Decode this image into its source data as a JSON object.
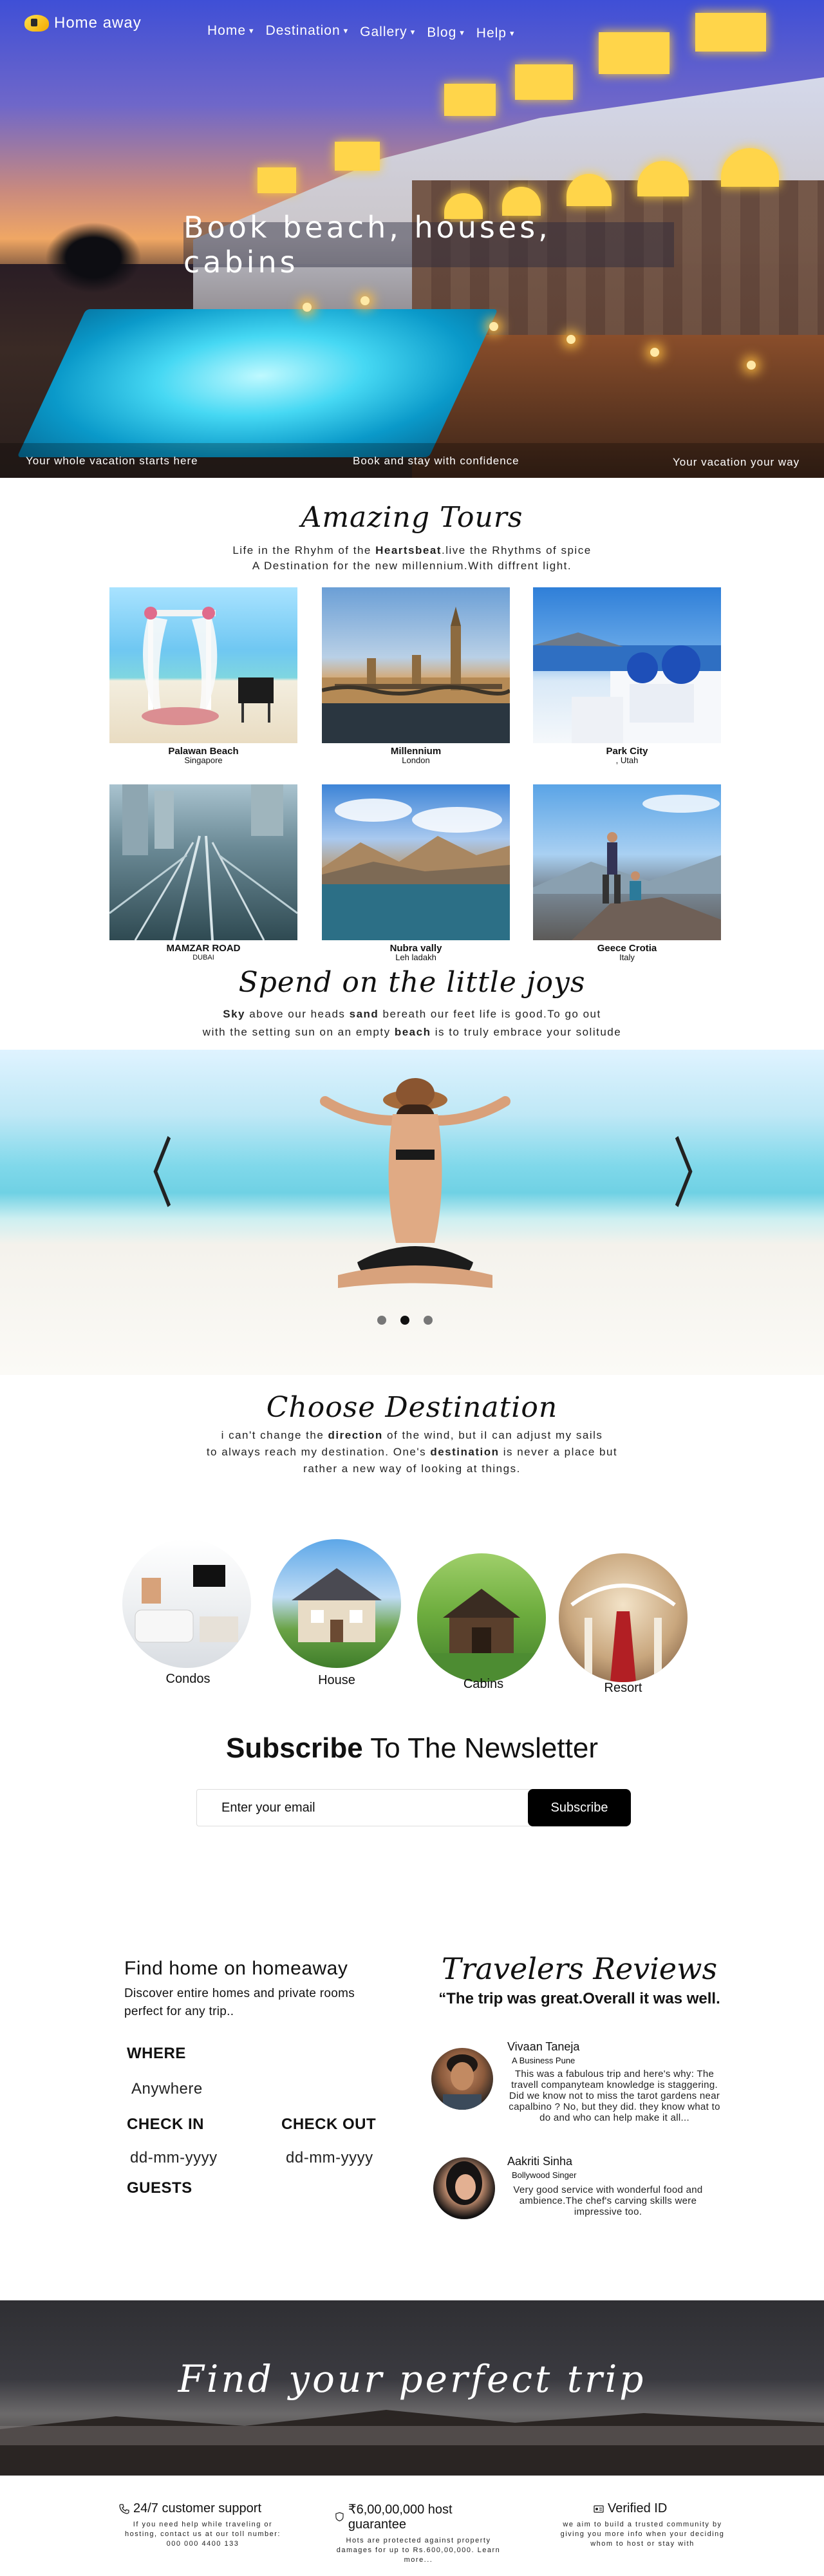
{
  "nav": {
    "logo": "Home away",
    "menu": [
      {
        "label": "Home"
      },
      {
        "label": "Destination"
      },
      {
        "label": "Gallery"
      },
      {
        "label": "Blog"
      },
      {
        "label": "Help"
      }
    ],
    "caret": "▾"
  },
  "hero": {
    "title": "Book beach, houses, cabins",
    "strip_left": "Your whole vacation starts here",
    "strip_center": "Book and stay with confidence",
    "strip_right": "Your vacation your way"
  },
  "tours": {
    "title": "Amazing Tours",
    "line1_pre": "Life in the Rhyhm of the ",
    "line1_bold": "Heartsbeat",
    "line1_post": ".live the Rhythms of spice",
    "line2": "A Destination for the new millennium.With diffrent light.",
    "cards": [
      {
        "name": "Palawan Beach",
        "loc": "Singapore"
      },
      {
        "name": "Millennium",
        "loc": "London"
      },
      {
        "name": "Park City",
        "loc": ", Utah"
      },
      {
        "name": "MAMZAR ROAD",
        "loc": "DUBAI"
      },
      {
        "name": "Nubra vally",
        "loc": "Leh ladakh"
      },
      {
        "name": "Geece Crotia",
        "loc": "Italy"
      }
    ]
  },
  "joys": {
    "title": "Spend on the little joys",
    "b1": "Sky",
    "t1": " above our heads ",
    "b2": "sand",
    "t2": " bereath our feet life is good.To go out",
    "t3": "with the setting sun on an empty ",
    "b3": "beach",
    "t4": " is to truly embrace your solitude"
  },
  "slider": {
    "prev": "〈",
    "next": "〉",
    "active_dot": 1
  },
  "destination": {
    "title": "Choose Destination",
    "l1_pre": "i can't change the ",
    "l1_bold": "direction",
    "l1_post": " of the wind, but iI can adjust my sails",
    "l2_pre": "to always reach my destination. One's ",
    "l2_bold": "destination",
    "l2_post": " is never a place but",
    "l3": "rather a new way of looking at things.",
    "items": [
      {
        "label": "Condos"
      },
      {
        "label": "House"
      },
      {
        "label": "Cabins"
      },
      {
        "label": "Resort"
      }
    ]
  },
  "subscribe": {
    "bold": "Subscribe",
    "rest": " To The Newsletter",
    "placeholder": "Enter your email",
    "button": "Subscribe"
  },
  "find": {
    "title": "Find home on homeaway",
    "desc": "Discover entire homes and private rooms perfect for any trip..",
    "where_label": "WHERE",
    "where_value": "Anywhere",
    "checkin_label": "CHECK IN",
    "checkin_value": "dd-mm-yyyy",
    "checkout_label": "CHECK OUT",
    "checkout_value": "dd-mm-yyyy",
    "guests_label": "GUESTS"
  },
  "reviews": {
    "title": "Travelers Reviews",
    "quote": "“The trip was great.Overall it was well.",
    "items": [
      {
        "name": "Vivaan Taneja",
        "role": "A Business Pune",
        "text": "This was a fabulous trip and here's why: The travell companyteam knowledge is staggering. Did we know not to miss the tarot gardens near capalbino ? No, but they did. they know what to do and who can help make it all..."
      },
      {
        "name": "Aakriti Sinha",
        "role": "Bollywood Singer",
        "text": "Very good service with wonderful food and ambience.The chef's carving skills were impressive too."
      }
    ]
  },
  "banner": {
    "title": "Find your perfect trip"
  },
  "footer": [
    {
      "icon": "phone-icon",
      "title": "24/7 customer support",
      "text": "If you need help while traveling or hosting, contact us at our toll number: 000 000 4400 133"
    },
    {
      "icon": "shield-icon",
      "title": "₹6,00,00,000 host guarantee",
      "text": "Hots are protected against property damages for up to Rs.600,00,000. Learn more..."
    },
    {
      "icon": "id-card-icon",
      "title": "Verified ID",
      "text": "we aim to build a trusted community by giving you more info when your deciding whom to host or stay with"
    }
  ]
}
